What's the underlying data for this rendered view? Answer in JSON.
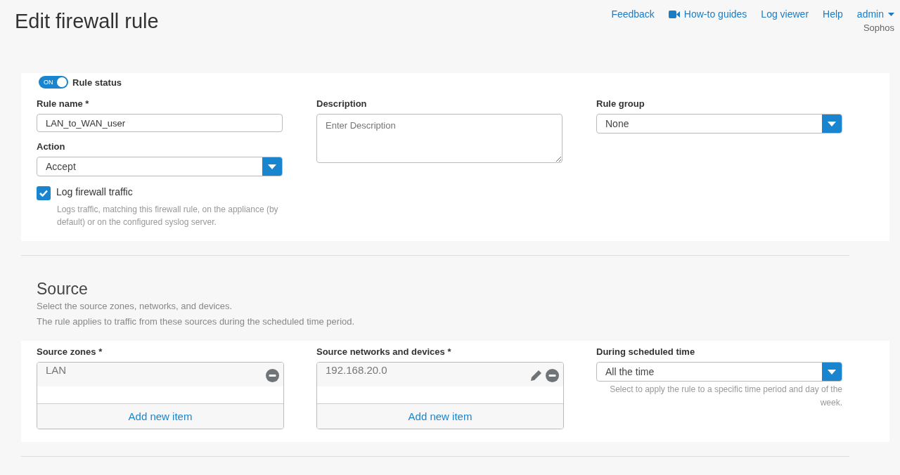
{
  "header": {
    "title": "Edit firewall rule",
    "links": [
      {
        "label": "Feedback",
        "kind": "text"
      },
      {
        "label": "How-to guides",
        "kind": "video"
      },
      {
        "label": "Log viewer",
        "kind": "text"
      },
      {
        "label": "Help",
        "kind": "text"
      }
    ],
    "user": "admin",
    "organization": "Sophos"
  },
  "rule_status": {
    "switch_text": "ON",
    "on": true,
    "label": "Rule status"
  },
  "rule_name": {
    "label": "Rule name *",
    "value": "LAN_to_WAN_user"
  },
  "action": {
    "label": "Action",
    "value": "Accept"
  },
  "log_traffic": {
    "label": "Log firewall traffic",
    "checked": true,
    "help": "Logs traffic, matching this firewall rule, on the appliance (by default) or on the configured syslog server."
  },
  "description": {
    "label": "Description",
    "placeholder": "Enter Description"
  },
  "rule_group": {
    "label": "Rule group",
    "value": "None"
  },
  "source": {
    "title": "Source",
    "subtitle_lines": [
      "Select the source zones, networks, and devices.",
      "The rule applies to traffic from these sources during the scheduled time period."
    ],
    "lists": [
      {
        "label": "Source zones *",
        "items": [
          {
            "text": "LAN",
            "editable": false
          }
        ],
        "add_label": "Add new item"
      },
      {
        "label": "Source networks and devices *",
        "items": [
          {
            "text": "192.168.20.0",
            "editable": true
          }
        ],
        "add_label": "Add new item"
      }
    ],
    "schedule": {
      "label": "During scheduled time",
      "value": "All the time",
      "help": "Select to apply the rule to a specific time period and day of the week."
    }
  }
}
